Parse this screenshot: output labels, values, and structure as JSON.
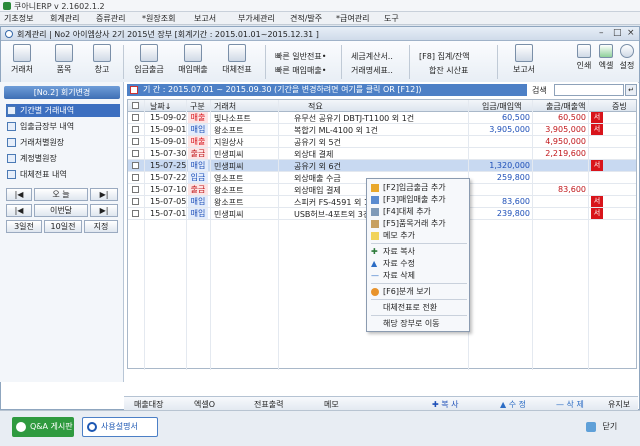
{
  "titlebar": {
    "title": "쿠아니ERP v 2.1602.1.2"
  },
  "menubar": [
    "기초정보",
    "회계관리",
    "증류관리",
    "*원장조회",
    "보고서",
    "부가세관리",
    "견적/발주",
    "*급여관리",
    "도구"
  ],
  "window": {
    "title": "회계관리 | No2 아이엠상사 2기 2015년 장부 [회계기간 : 2015.01.01~2015.12.31 ]",
    "controls": [
      "–",
      "□",
      "×"
    ]
  },
  "toolbar": {
    "left": [
      {
        "label": "거래처"
      },
      {
        "label": "품목"
      },
      {
        "label": "창고"
      },
      {
        "label": "입금출금"
      },
      {
        "label": "매입매출"
      },
      {
        "label": "대체전표"
      }
    ],
    "quick": [
      "빠른 일반전표•",
      "빠른 매입매출•"
    ],
    "tax": [
      "세금계산서..",
      "거래명세표.."
    ],
    "summary": [
      "[F8] 집계/잔액",
      "합잔 시산표"
    ],
    "report": "보고서",
    "right": [
      "인쇄",
      "엑셀",
      "설정"
    ]
  },
  "leftpanel": {
    "header": "[No.2] 회기변경",
    "items": [
      "기간별 거래내역",
      "입출금장부 내역",
      "거래처별원장",
      "계정별원장",
      "대체전표 내역"
    ],
    "nav": [
      [
        "|◀",
        "오 늘",
        "▶|"
      ],
      [
        "|◀",
        "이번달",
        "▶|"
      ],
      [
        "3일전",
        "10일전",
        "지정"
      ]
    ]
  },
  "period": {
    "text": "기 간 : 2015.07.01 ~ 2015.09.30   (기간을 변경하려면 여기를 클릭 OR [F12])",
    "search_label": "검색",
    "search_value": ""
  },
  "grid": {
    "headers": [
      "날짜↓",
      "구분",
      "거래처",
      "적요",
      "입금/매입액",
      "출금/매출액",
      "증빙"
    ],
    "rows": [
      {
        "date": "15-09-02",
        "gubun": "매출",
        "type": "sale",
        "client": "빛나소프트",
        "desc": "유무선 공유기 DBTJ-T1100 외 1건",
        "in": "60,500",
        "out": "60,500",
        "badge": "서",
        "sel": false
      },
      {
        "date": "15-09-01",
        "gubun": "매입",
        "type": "buy",
        "client": "왕소프트",
        "desc": "복합기 ML-4100 외 1건",
        "in": "3,905,000",
        "out": "3,905,000",
        "badge": "서",
        "sel": false
      },
      {
        "date": "15-09-01",
        "gubun": "매출",
        "type": "sale",
        "client": "지원상사",
        "desc": "공유기 외 5건",
        "in": "",
        "out": "4,950,000",
        "badge": "",
        "sel": false
      },
      {
        "date": "15-07-30",
        "gubun": "출금",
        "type": "out",
        "client": "민생피씨",
        "desc": "외상대 결제",
        "in": "",
        "out": "2,219,600",
        "badge": "",
        "sel": false
      },
      {
        "date": "15-07-25",
        "gubun": "매입",
        "type": "buy",
        "client": "민생피씨",
        "desc": "공유기 외 6건",
        "in": "1,320,000",
        "out": "",
        "badge": "서",
        "sel": true
      },
      {
        "date": "15-07-22",
        "gubun": "입금",
        "type": "in",
        "client": "영소프트",
        "desc": "외상매출 수금",
        "in": "259,800",
        "out": "",
        "badge": "",
        "sel": false
      },
      {
        "date": "15-07-10",
        "gubun": "출금",
        "type": "out",
        "client": "왕소프트",
        "desc": "외상매입 결제",
        "in": "",
        "out": "83,600",
        "badge": "",
        "sel": false
      },
      {
        "date": "15-07-05",
        "gubun": "매입",
        "type": "buy",
        "client": "왕소프트",
        "desc": "스피커 FS-4591 외 1건",
        "in": "83,600",
        "out": "",
        "badge": "서",
        "sel": false
      },
      {
        "date": "15-07-01",
        "gubun": "매입",
        "type": "buy",
        "client": "민생피씨",
        "desc": "USB허브-4포트외 3건",
        "in": "239,800",
        "out": "",
        "badge": "서",
        "sel": false
      }
    ]
  },
  "context_menu": {
    "items": [
      "[F2]입금출금 추가",
      "[F3]매입매출 추가",
      "[F4]대체 추가",
      "[F5]품목거래 추가",
      "메모 추가"
    ],
    "items2": [
      "자료 복사",
      "자료 수정",
      "자료 삭제"
    ],
    "items3": [
      "[F6]분개 보기"
    ],
    "items4": [
      "대체전표로 전환"
    ],
    "items5": [
      "해당 장부로 이동"
    ]
  },
  "bottombar": [
    "매출대장",
    "엑셀O",
    "전표출력",
    "메모",
    "✚ 복 사",
    "▲ 수 정",
    "— 삭 제",
    "유지보"
  ],
  "footer": {
    "qna": "Q&A 게시판",
    "manual": "사용설명서",
    "close": "닫기"
  },
  "colors": {
    "accent": "#3c6fc0",
    "sale": "#d8141b",
    "buy": "#1d4fb8",
    "out": "#c0161a",
    "in": "#1d4fb8"
  }
}
